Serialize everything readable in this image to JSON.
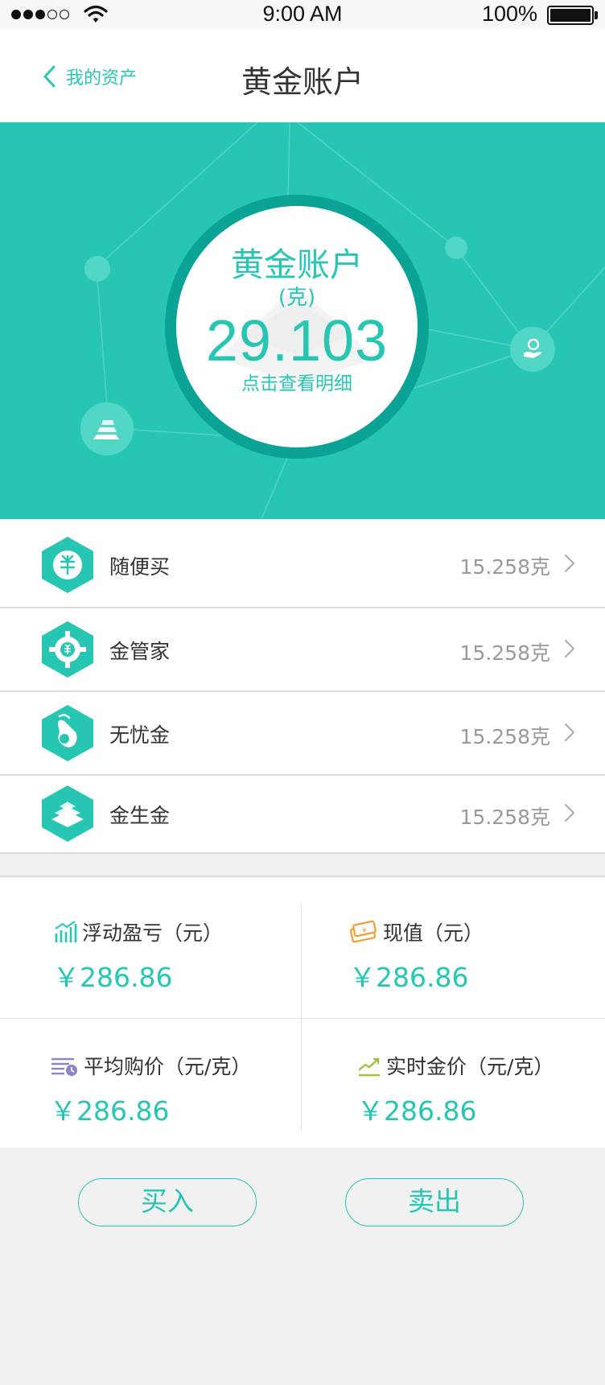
{
  "status_bar": {
    "time": "9:00 AM",
    "battery": "100%"
  },
  "nav": {
    "back_label": "我的资产",
    "title": "黄金账户"
  },
  "summary": {
    "title": "黄金账户",
    "unit": "(克)",
    "value": "29.103",
    "detail_link": "点击查看明细"
  },
  "accounts": [
    {
      "label": "随便买",
      "value": "15.258克",
      "icon": "yuan-bag-icon"
    },
    {
      "label": "金管家",
      "value": "15.258克",
      "icon": "gear-yuan-icon"
    },
    {
      "label": "无忧金",
      "value": "15.258克",
      "icon": "hand-coin-icon"
    },
    {
      "label": "金生金",
      "value": "15.258克",
      "icon": "gold-bars-icon"
    }
  ],
  "stats": [
    {
      "label": "浮动盈亏（元）",
      "value": "￥286.86",
      "icon": "bar-chart-icon",
      "color": "#26c6b3"
    },
    {
      "label": "现值（元）",
      "value": "￥286.86",
      "icon": "banknote-icon",
      "color": "#f0a030"
    },
    {
      "label": "平均购价（元/克）",
      "value": "￥286.86",
      "icon": "list-clock-icon",
      "color": "#8b86c9"
    },
    {
      "label": "实时金价（元/克）",
      "value": "￥286.86",
      "icon": "trend-line-icon",
      "color": "#9cc43a"
    }
  ],
  "actions": {
    "buy": "买入",
    "sell": "卖出"
  },
  "colors": {
    "accent": "#26c6b3",
    "hero_bg": "#27c6b4",
    "ring": "#0aa395"
  }
}
